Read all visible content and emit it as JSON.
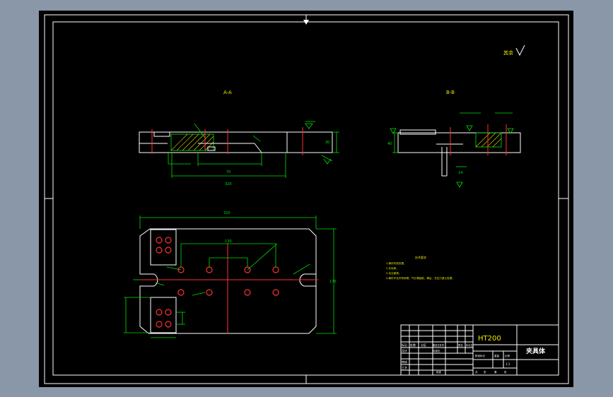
{
  "drawing": {
    "section_a_label": "A-A",
    "section_b_label": "B-B",
    "roughness_note": "其余",
    "material": "HT200",
    "part_name": "夹具体",
    "notes_title": "技术要求",
    "notes": [
      "1.铸件时效处理。",
      "2.去毛刺。",
      "3.未注倒角。",
      "4.铸件不允许有砂眼、气孔等缺陷，铸后，去应力退火处理。"
    ],
    "title_block": {
      "row_labels": [
        "标记",
        "设计",
        "审核",
        "工艺"
      ],
      "col_labels": [
        "处数",
        "分区",
        "更改文件号",
        "签名",
        "年月日"
      ],
      "stage_labels": [
        "阶段标记",
        "重量",
        "比例"
      ],
      "scale": "1:1",
      "sheet_labels": [
        "共",
        "张",
        "第",
        "张"
      ],
      "standardize": "标准化",
      "approve": "批准"
    },
    "dims": {
      "top_len": "320",
      "top_inner": "70",
      "top_height": "30",
      "plan_len": "320",
      "plan_height": "170",
      "plan_inner": "130",
      "b_width": "40",
      "b_depth": "14"
    }
  }
}
